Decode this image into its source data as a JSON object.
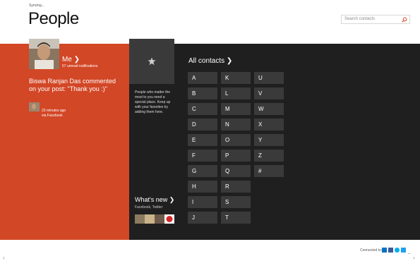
{
  "header": {
    "status": "Syncing...",
    "title": "People",
    "search_placeholder": "Search contacts"
  },
  "me": {
    "label": "Me ❯",
    "unread": "57 unread notifications",
    "post": "Biswa Ranjan Das commented on your post: \"Thank you :)\"",
    "time": "23 minutes ago",
    "via": "via Facebook"
  },
  "favorites": {
    "text": "People who matter the most to you need a special place. Keep up with your favorites by adding them here."
  },
  "whats_new": {
    "title": "What's new ❯",
    "subtitle": "Facebook, Twitter"
  },
  "all_contacts": {
    "title": "All contacts ❯",
    "letters": [
      "A",
      "B",
      "C",
      "D",
      "E",
      "F",
      "G",
      "H",
      "I",
      "J",
      "K",
      "L",
      "M",
      "N",
      "O",
      "P",
      "Q",
      "R",
      "S",
      "T",
      "U",
      "V",
      "W",
      "X",
      "Y",
      "Z",
      "#"
    ]
  },
  "footer": {
    "connected": "Connected to:",
    "services": [
      "outlook-icon",
      "facebook-icon",
      "skype-icon",
      "twitter-icon"
    ]
  },
  "colors": {
    "accent": "#d24726",
    "dark": "#1f1f1f",
    "tile": "#3a3a3a"
  }
}
